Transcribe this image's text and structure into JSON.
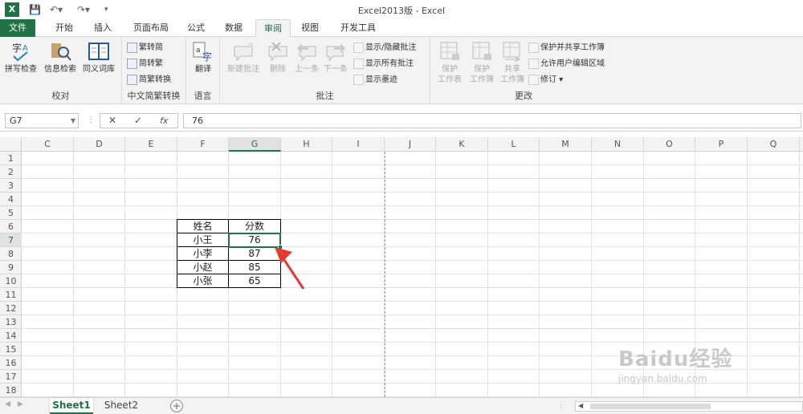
{
  "app": {
    "title": "Excel2013版 - Excel",
    "icon_label": "X"
  },
  "quick_access": [
    "save-icon",
    "undo-icon",
    "redo-icon",
    "customize-icon"
  ],
  "tabs": [
    {
      "label": "文件"
    },
    {
      "label": "开始"
    },
    {
      "label": "插入"
    },
    {
      "label": "页面布局"
    },
    {
      "label": "公式"
    },
    {
      "label": "数据"
    },
    {
      "label": "审阅"
    },
    {
      "label": "视图"
    },
    {
      "label": "开发工具"
    }
  ],
  "active_tab": "审阅",
  "ribbon": {
    "proofing": {
      "group": "校对",
      "spell": "拼写检查",
      "research": "信息检索",
      "thesaurus": "同义词库"
    },
    "chinese": {
      "group": "中文简繁转换",
      "to_trad": "繁转简",
      "to_simp": "简转繁",
      "convert": "简繁转换"
    },
    "language": {
      "group": "语言",
      "translate": "翻译"
    },
    "comments": {
      "group": "批注",
      "new": "新建批注",
      "delete": "删除",
      "prev": "上一条",
      "next": "下一条",
      "show_hide": "显示/隐藏批注",
      "show_all": "显示所有批注",
      "show_ink": "显示墨迹"
    },
    "changes": {
      "group": "更改",
      "protect_sheet_1": "保护",
      "protect_sheet_2": "工作表",
      "protect_wb_1": "保护",
      "protect_wb_2": "工作簿",
      "share_1": "共享",
      "share_2": "工作簿",
      "protect_share": "保护并共享工作簿",
      "allow_edit": "允许用户编辑区域",
      "track": "修订"
    }
  },
  "formula_bar": {
    "name_box": "G7",
    "cancel": "✕",
    "enter": "✓",
    "fx": "fx",
    "value": "76"
  },
  "grid": {
    "columns": [
      "C",
      "D",
      "E",
      "F",
      "G",
      "H",
      "I",
      "J",
      "K",
      "L",
      "M",
      "N",
      "O",
      "P",
      "Q"
    ],
    "rows": [
      "1",
      "2",
      "3",
      "4",
      "5",
      "6",
      "7",
      "8",
      "9",
      "10",
      "11",
      "12",
      "13",
      "14",
      "15",
      "16",
      "17",
      "18"
    ],
    "selected_column": "G",
    "selected_row": "7",
    "table": {
      "headers": [
        "姓名",
        "分数"
      ],
      "rows": [
        [
          "小王",
          "76"
        ],
        [
          "小李",
          "87"
        ],
        [
          "小赵",
          "85"
        ],
        [
          "小张",
          "65"
        ]
      ]
    }
  },
  "sheets": {
    "tabs": [
      "Sheet1",
      "Sheet2"
    ],
    "active": "Sheet1",
    "add_label": "+"
  },
  "watermark": {
    "line1": "Baidu经验",
    "line2": "jingyan.baidu.com"
  },
  "colors": {
    "accent": "#217346",
    "arrow": "#e53a32"
  }
}
